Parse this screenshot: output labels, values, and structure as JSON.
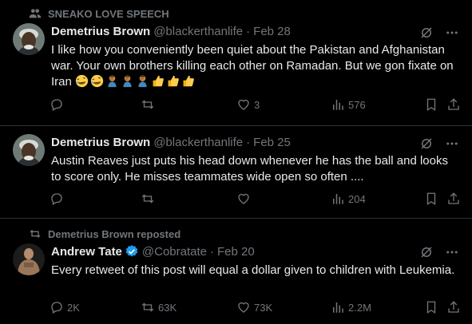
{
  "tweets": [
    {
      "social_context": "SNEAKO LOVE SPEECH",
      "name": "Demetrius Brown",
      "handle": "@blackerthanlife",
      "dot": "·",
      "date": "Feb 28",
      "text": "I like how you conveniently been quiet about the Pakistan and Afghanistan war. Your own brothers killing each other on Ramadan. But we gon fixate on Iran",
      "emojis": [
        "rofl",
        "rofl",
        "facepalm",
        "facepalm",
        "facepalm",
        "thumbs-up",
        "thumbs-up",
        "thumbs-up"
      ],
      "reply_count": "",
      "repost_count": "",
      "like_count": "3",
      "view_count": "576"
    },
    {
      "name": "Demetrius Brown",
      "handle": "@blackerthanlife",
      "dot": "·",
      "date": "Feb 25",
      "text": "Austin Reaves just puts his head down whenever he has the ball and looks to score only. He misses teammates wide open so often ....",
      "reply_count": "",
      "repost_count": "",
      "like_count": "",
      "view_count": "204"
    },
    {
      "social_context": "Demetrius Brown reposted",
      "name": "Andrew Tate",
      "handle": "@Cobratate",
      "dot": "·",
      "date": "Feb 20",
      "text": "Every retweet of this post will equal a dollar given to children with Leukemia.",
      "reply_count": "2K",
      "repost_count": "63K",
      "like_count": "73K",
      "view_count": "2.2M"
    }
  ],
  "colors": {
    "background": "#000000",
    "text": "#e7e9ea",
    "muted": "#71767b",
    "divider": "#2f3336",
    "verified": "#1d9bf0"
  }
}
